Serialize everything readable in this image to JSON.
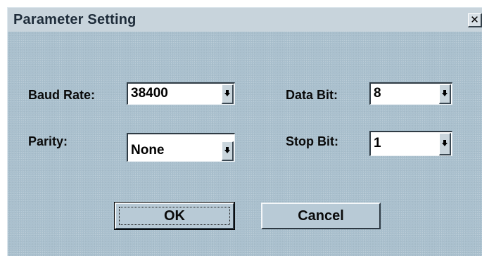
{
  "window": {
    "title": "Parameter Setting",
    "close_glyph": "✕"
  },
  "fields": {
    "baud_rate": {
      "label": "Baud Rate:",
      "value": "38400"
    },
    "data_bit": {
      "label": "Data Bit:",
      "value": "8"
    },
    "parity": {
      "label": "Parity:",
      "value": "None"
    },
    "stop_bit": {
      "label": "Stop Bit:",
      "value": "1"
    }
  },
  "buttons": {
    "ok_label": "OK",
    "cancel_label": "Cancel"
  },
  "icons": {
    "close": "close-icon",
    "dropdown": "chevron-down-icon"
  },
  "colors": {
    "dialog_background": "#a9bfcd",
    "titlebar_background": "#c8d4dc",
    "title_text": "#1e2c3a"
  }
}
